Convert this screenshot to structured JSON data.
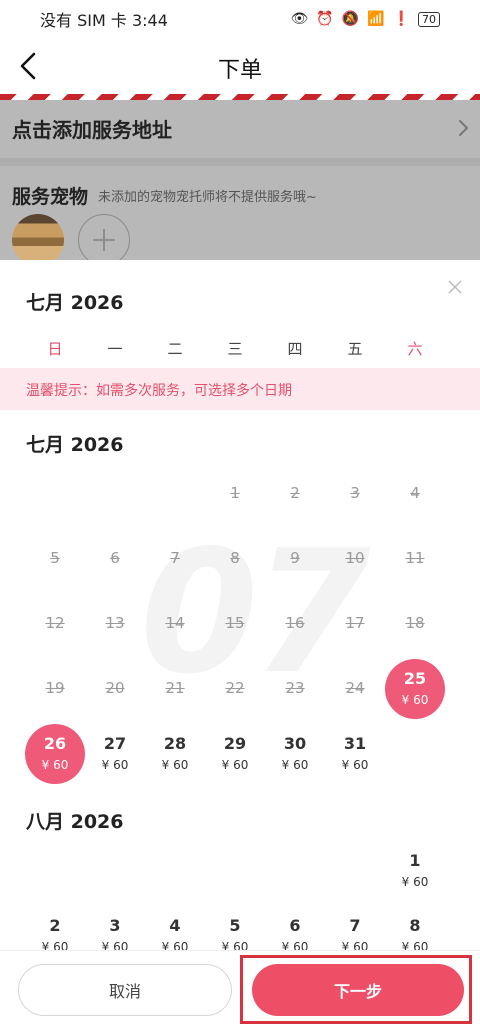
{
  "status_bar": {
    "carrier_time": "没有 SIM 卡 3:44",
    "battery": "70"
  },
  "nav": {
    "title": "下单"
  },
  "address": {
    "label": "点击添加服务地址"
  },
  "pets": {
    "title": "服务宠物",
    "hint": "未添加的宠物宠托师将不提供服务哦~"
  },
  "sheet": {
    "header_month": "七月 2026",
    "weekdays": [
      "日",
      "一",
      "二",
      "三",
      "四",
      "五",
      "六"
    ],
    "tip": "温馨提示：如需多次服务，可选择多个日期",
    "watermark": "07",
    "months": [
      {
        "title": "七月 2026",
        "days": [
          {
            "d": "1",
            "price": "",
            "state": "past"
          },
          {
            "d": "2",
            "price": "",
            "state": "past"
          },
          {
            "d": "3",
            "price": "",
            "state": "past"
          },
          {
            "d": "4",
            "price": "",
            "state": "past"
          },
          {
            "d": "5",
            "price": "",
            "state": "past"
          },
          {
            "d": "6",
            "price": "",
            "state": "past"
          },
          {
            "d": "7",
            "price": "",
            "state": "past"
          },
          {
            "d": "8",
            "price": "",
            "state": "past"
          },
          {
            "d": "9",
            "price": "",
            "state": "past"
          },
          {
            "d": "10",
            "price": "",
            "state": "past"
          },
          {
            "d": "11",
            "price": "",
            "state": "past"
          },
          {
            "d": "12",
            "price": "",
            "state": "past"
          },
          {
            "d": "13",
            "price": "",
            "state": "past"
          },
          {
            "d": "14",
            "price": "",
            "state": "past"
          },
          {
            "d": "15",
            "price": "",
            "state": "past"
          },
          {
            "d": "16",
            "price": "",
            "state": "past"
          },
          {
            "d": "17",
            "price": "",
            "state": "past"
          },
          {
            "d": "18",
            "price": "",
            "state": "past"
          },
          {
            "d": "19",
            "price": "",
            "state": "past"
          },
          {
            "d": "20",
            "price": "",
            "state": "past"
          },
          {
            "d": "21",
            "price": "",
            "state": "past"
          },
          {
            "d": "22",
            "price": "",
            "state": "past"
          },
          {
            "d": "23",
            "price": "",
            "state": "past"
          },
          {
            "d": "24",
            "price": "",
            "state": "past"
          },
          {
            "d": "25",
            "price": "¥ 60",
            "state": "selected"
          },
          {
            "d": "26",
            "price": "¥ 60",
            "state": "selected"
          },
          {
            "d": "27",
            "price": "¥ 60",
            "state": "available"
          },
          {
            "d": "28",
            "price": "¥ 60",
            "state": "available"
          },
          {
            "d": "29",
            "price": "¥ 60",
            "state": "available"
          },
          {
            "d": "30",
            "price": "¥ 60",
            "state": "available"
          },
          {
            "d": "31",
            "price": "¥ 60",
            "state": "available"
          }
        ]
      },
      {
        "title": "八月 2026",
        "days": [
          {
            "d": "1",
            "price": "¥ 60",
            "state": "available"
          },
          {
            "d": "2",
            "price": "¥ 60",
            "state": "available"
          },
          {
            "d": "3",
            "price": "¥ 60",
            "state": "available"
          },
          {
            "d": "4",
            "price": "¥ 60",
            "state": "available"
          },
          {
            "d": "5",
            "price": "¥ 60",
            "state": "available"
          },
          {
            "d": "6",
            "price": "¥ 60",
            "state": "available"
          },
          {
            "d": "7",
            "price": "¥ 60",
            "state": "available"
          },
          {
            "d": "8",
            "price": "¥ 60",
            "state": "available"
          }
        ]
      }
    ]
  },
  "footer": {
    "cancel_label": "取消",
    "next_label": "下一步"
  }
}
